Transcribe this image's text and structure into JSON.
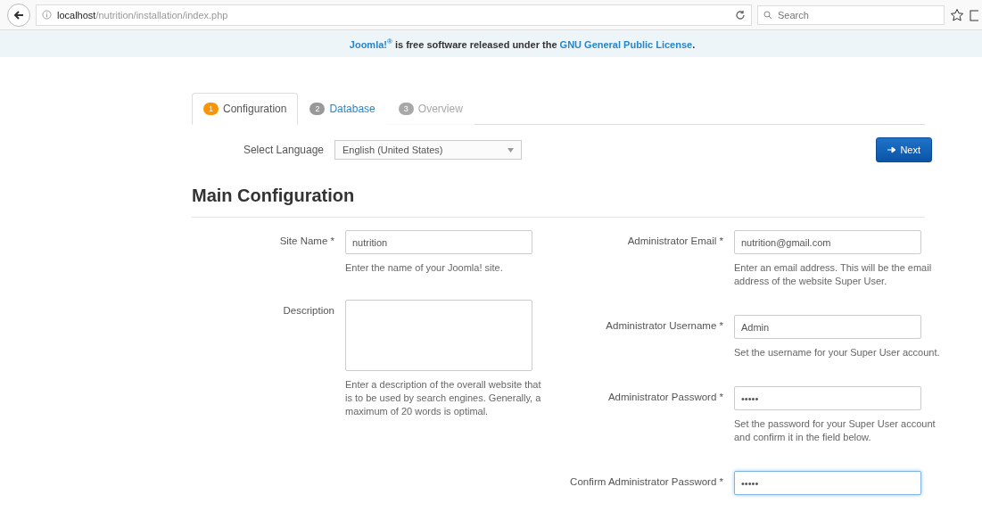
{
  "browser": {
    "url": "**localhost**/nutrition/installation/index.php",
    "search": {
      "placeholder": "Search"
    }
  },
  "banner": [
    {
      "kind": "link",
      "text": "Joomla!$^{®}$"
    },
    {
      "kind": "text",
      "text": " is free software released under the "
    },
    {
      "kind": "link",
      "text": "GNU General Public License"
    },
    {
      "kind": "text",
      "text": "."
    }
  ],
  "tabs": [
    {
      "number": "1",
      "label": "Configuration",
      "selected": true,
      "disabled": false
    },
    {
      "number": "2",
      "label": "Database",
      "selected": false,
      "disabled": false
    },
    {
      "number": "3",
      "label": "Overview",
      "selected": false,
      "disabled": true
    }
  ],
  "language": {
    "label": "Select Language",
    "value": "English (United States)"
  },
  "next_button": "Next",
  "heading": "Main Configuration",
  "columns": [
    [
      {
        "kind": "input",
        "label": "Site Name *",
        "value": "nutrition",
        "help": "Enter the name of your Joomla! site.",
        "focused": false
      },
      {
        "kind": "textarea",
        "label": "Description",
        "help": "Enter a description of the overall website that is to be used by search engines. Generally, a maximum of 20 words is optimal.",
        "focused": false
      }
    ],
    [
      {
        "kind": "input",
        "label": "Administrator Email *",
        "value": "nutrition@gmail.com",
        "help": "Enter an email address. This will be the email address of the website Super User.",
        "focused": false
      },
      {
        "kind": "input",
        "label": "Administrator Username *",
        "value": "Admin",
        "help": "Set the username for your Super User account.",
        "focused": false
      },
      {
        "kind": "input",
        "label": "Administrator Password *",
        "value": "•••••",
        "help": "Set the password for your Super User account and confirm it in the field below.",
        "focused": false
      },
      {
        "kind": "input",
        "label": "Confirm Administrator Password *",
        "value": "•••••",
        "focused": true
      }
    ]
  ]
}
